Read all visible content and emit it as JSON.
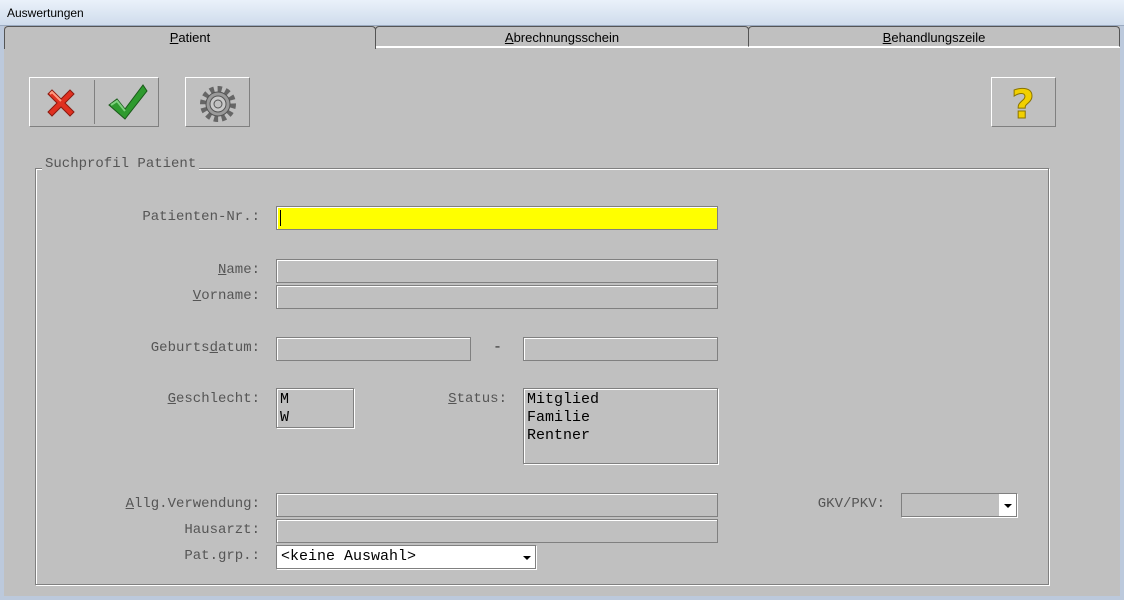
{
  "window": {
    "title": "Auswertungen"
  },
  "tabs": [
    {
      "label_pre": "",
      "label_key": "P",
      "label_post": "atient"
    },
    {
      "label_pre": "",
      "label_key": "A",
      "label_post": "brechnungsschein"
    },
    {
      "label_pre": "",
      "label_key": "B",
      "label_post": "ehandlungszeile"
    }
  ],
  "group": {
    "title": "Suchprofil Patient"
  },
  "labels": {
    "patient_nr": "Patienten-Nr.:",
    "name_key": "N",
    "name_rest": "ame:",
    "vorname_key": "V",
    "vorname_rest": "orname:",
    "geb_pre": "Geburts",
    "geb_key": "d",
    "geb_post": "atum:",
    "geschlecht_key": "G",
    "geschlecht_rest": "eschlecht:",
    "status_key": "S",
    "status_rest": "tatus:",
    "allg_key": "A",
    "allg_rest": "llg.Verwendung:",
    "hausarzt": "Hausarzt:",
    "patgrp": "Pat.grp.:",
    "gkvpkv": "GKV/PKV:"
  },
  "geburtsdatum_separator": "-",
  "geschlecht_options": [
    "M",
    "W"
  ],
  "status_options": [
    "Mitglied",
    "Familie",
    "Rentner"
  ],
  "patgrp_value": "<keine Auswahl>",
  "gkvpkv_value": "",
  "colors": {
    "active_field": "#ffff00",
    "panel": "#c0c0c0",
    "cancel": "#e03020",
    "ok": "#2e9a2e",
    "help": "#f2d000"
  }
}
